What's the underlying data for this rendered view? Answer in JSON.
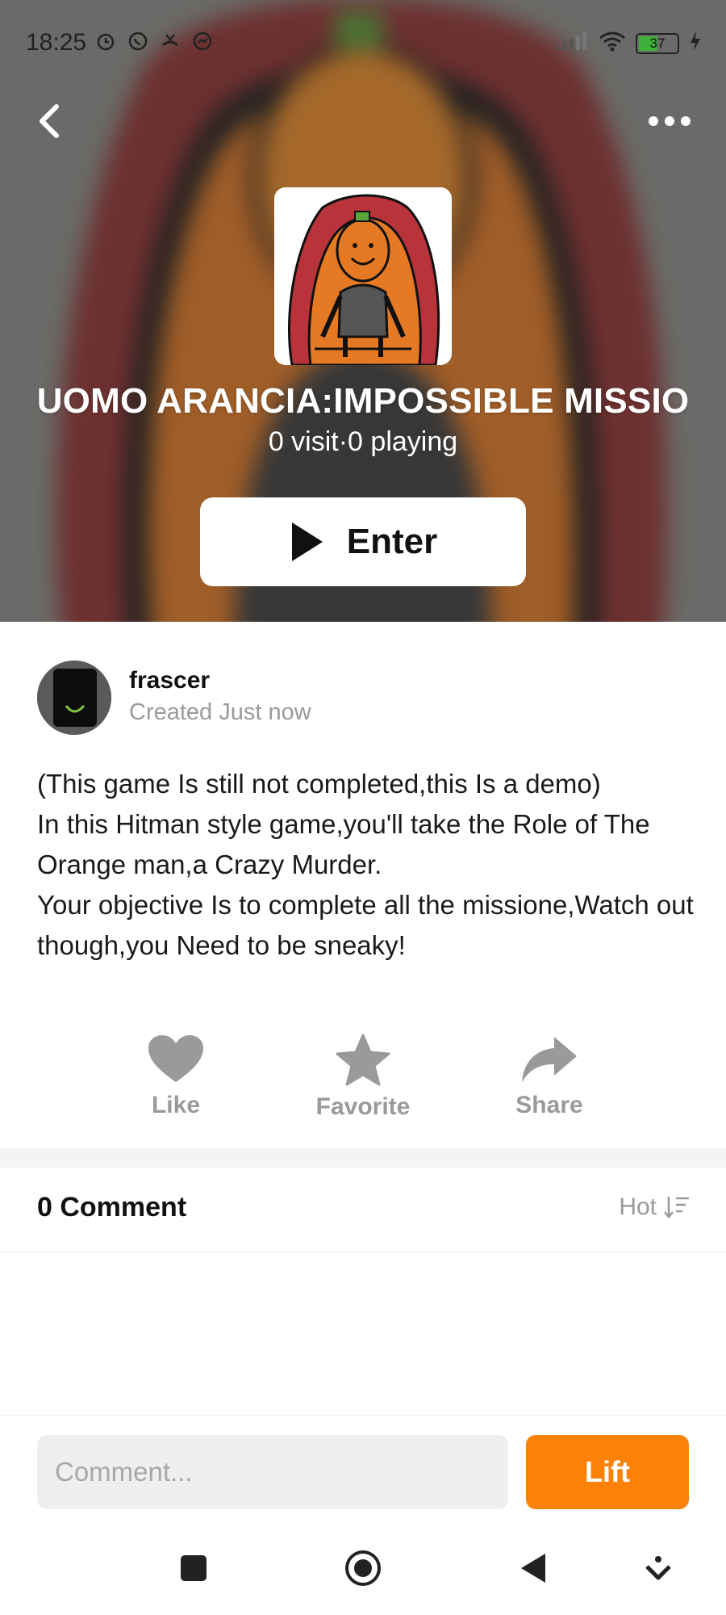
{
  "status_bar": {
    "time": "18:25",
    "battery": "37",
    "left_icons": [
      "alarm-icon",
      "whatsapp-icon",
      "missed-call-icon",
      "messenger-icon"
    ],
    "right_icons": [
      "signal-icon",
      "wifi-icon",
      "battery-icon",
      "charging-icon"
    ]
  },
  "header": {
    "back_icon": "chevron-left-icon",
    "more_icon": "more-dots-icon"
  },
  "game": {
    "title": "UOMO ARANCIA:IMPOSSIBLE MISSIO",
    "stats": "0 visit·0 playing",
    "enter_label": "Enter"
  },
  "author": {
    "name": "frascer",
    "created": "Created Just now"
  },
  "description": "(This game Is still not completed,this Is a demo)\nIn this Hitman style game,you'll take the Role of The Orange man,a Crazy Murder.\nYour objective Is to complete all the missione,Watch out though,you Need to be sneaky!",
  "actions": [
    {
      "label": "Like",
      "icon": "heart-icon"
    },
    {
      "label": "Favorite",
      "icon": "star-icon"
    },
    {
      "label": "Share",
      "icon": "share-arrow-icon"
    }
  ],
  "comments": {
    "count_label": "0 Comment",
    "sort_label": "Hot"
  },
  "comment_bar": {
    "placeholder": "Comment...",
    "submit_label": "Lift"
  },
  "colors": {
    "accent": "#fb8206",
    "muted_text": "#9a9a9a"
  },
  "nav_bar": [
    "square-icon",
    "home-circle-icon",
    "back-triangle-icon",
    "accessibility-icon"
  ]
}
